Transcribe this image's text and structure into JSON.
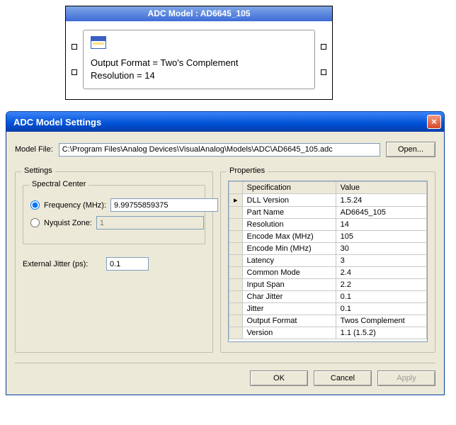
{
  "topBlock": {
    "title": "ADC Model : AD6645_105",
    "line1": "Output Format = Two's Complement",
    "line2": "Resolution = 14"
  },
  "dialog": {
    "title": "ADC Model Settings",
    "modelFileLabel": "Model File:",
    "modelFilePath": "C:\\Program Files\\Analog Devices\\VisualAnalog\\Models\\ADC\\AD6645_105.adc",
    "openLabel": "Open...",
    "settingsLegend": "Settings",
    "spectralLegend": "Spectral Center",
    "frequencyLabel": "Frequency (MHz):",
    "frequencyValue": "9.99755859375",
    "nyquistLabel": "Nyquist Zone:",
    "nyquistValue": "1",
    "extJitterLabel": "External Jitter (ps):",
    "extJitterValue": "0.1",
    "propertiesLegend": "Properties",
    "col1": "Specification",
    "col2": "Value",
    "props": [
      {
        "spec": "DLL Version",
        "val": "1.5.24"
      },
      {
        "spec": "Part Name",
        "val": "AD6645_105"
      },
      {
        "spec": "Resolution",
        "val": "14"
      },
      {
        "spec": "Encode Max (MHz)",
        "val": "105"
      },
      {
        "spec": "Encode Min (MHz)",
        "val": "30"
      },
      {
        "spec": "Latency",
        "val": "3"
      },
      {
        "spec": "Common Mode",
        "val": "2.4"
      },
      {
        "spec": "Input Span",
        "val": "2.2"
      },
      {
        "spec": "Char Jitter",
        "val": "0.1"
      },
      {
        "spec": "Jitter",
        "val": "0.1"
      },
      {
        "spec": "Output Format",
        "val": "Twos Complement"
      },
      {
        "spec": "Version",
        "val": "1.1 (1.5.2)"
      }
    ],
    "okLabel": "OK",
    "cancelLabel": "Cancel",
    "applyLabel": "Apply"
  },
  "figureId": "06683-048"
}
